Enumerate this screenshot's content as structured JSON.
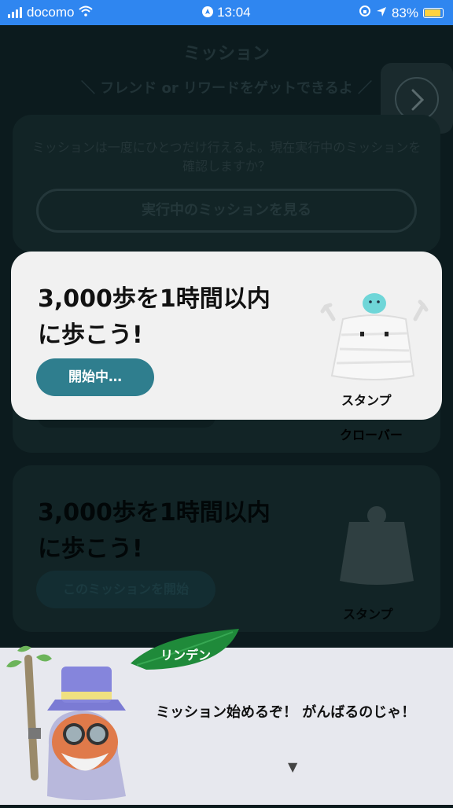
{
  "status": {
    "carrier": "docomo",
    "time": "13:04",
    "battery": "83%",
    "battery_level": 0.83
  },
  "background": {
    "title": "ミッション",
    "subtitle": "＼ フレンド or リワードをゲットできるよ ／",
    "info_text": "ミッションは一度にひとつだけ行えるよ。現在実行中のミッションを確認しますか？",
    "view_active_button": "実行中のミッションを見る",
    "reward_clover": "クローバー",
    "mission_title_1": "3,000歩を1時間以内",
    "mission_title_2": "に歩こう!",
    "start_button": "このミッションを開始",
    "reward_stamp": "スタンプ"
  },
  "modal": {
    "title_1": "3,000歩を1時間以内",
    "title_2": "に歩こう!",
    "status_button": "開始中…",
    "reward": "スタンプ"
  },
  "dialog": {
    "speaker": "リンデン",
    "message": "ミッション始めるぞ！ がんばるのじゃ！",
    "next_indicator": "▼"
  },
  "icons": {
    "next": "chevron-right-icon",
    "mascot": "tofu-ghost-mascot",
    "character": "wizard-character"
  }
}
